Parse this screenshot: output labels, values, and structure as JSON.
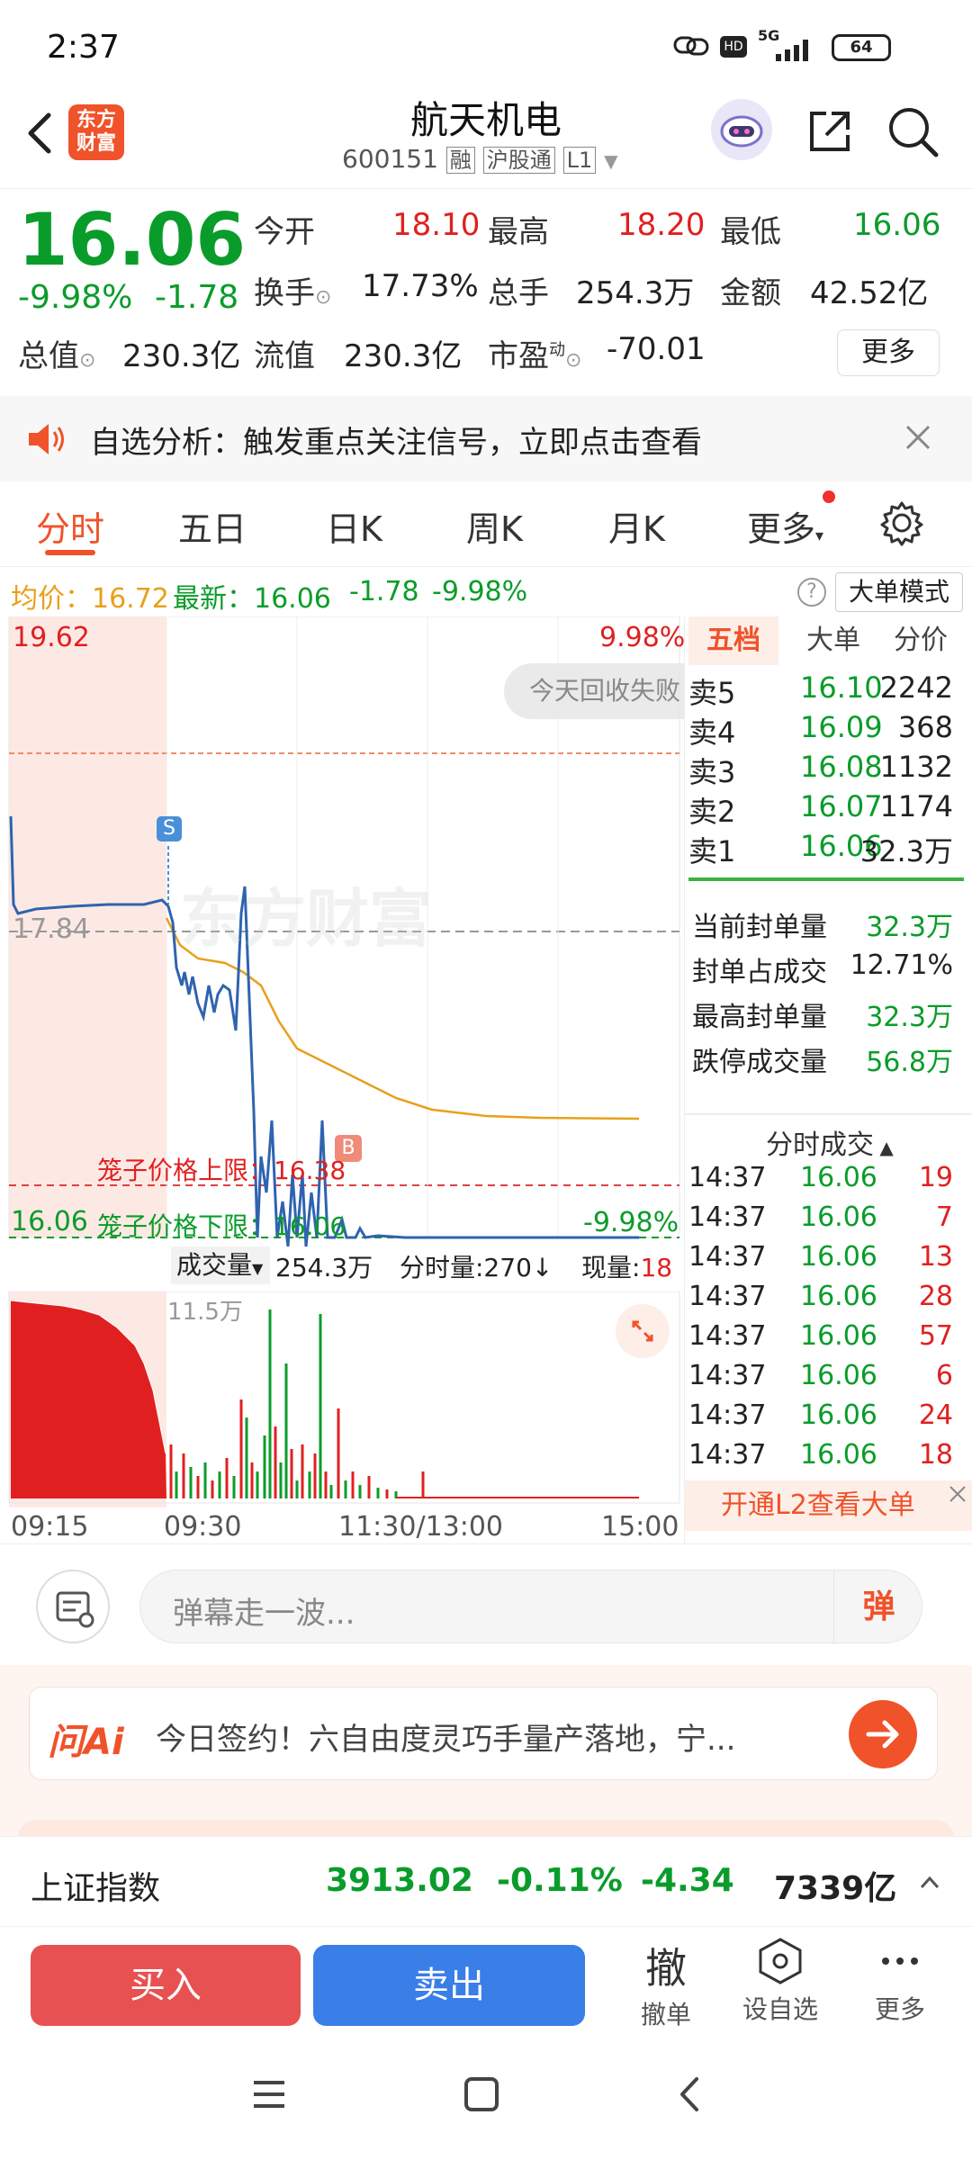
{
  "status_bar": {
    "time": "2:37",
    "network": "5G",
    "battery": "64"
  },
  "header": {
    "stock_name": "航天机电",
    "code": "600151",
    "tag1": "融",
    "tag2": "沪股通",
    "tag3": "L1",
    "brand_line1": "东方",
    "brand_line2": "财富"
  },
  "quote": {
    "price": "16.06",
    "change_pct": "-9.98%",
    "change": "-1.78",
    "open_label": "今开",
    "open": "18.10",
    "high_label": "最高",
    "high": "18.20",
    "low_label": "最低",
    "low": "16.06",
    "turnover_label": "换手",
    "turnover": "17.73%",
    "volume_label": "总手",
    "volume": "254.3万",
    "amount_label": "金额",
    "amount": "42.52亿",
    "mktcap_label": "总值",
    "mktcap": "230.3亿",
    "float_label": "流值",
    "float": "230.3亿",
    "pe_label": "市盈",
    "pe_sup": "动",
    "pe": "-70.01",
    "more_label": "更多"
  },
  "banner": {
    "text": "自选分析：触发重点关注信号，立即点击查看"
  },
  "tabs": [
    "分时",
    "五日",
    "日K",
    "周K",
    "月K",
    "更多"
  ],
  "infobar": {
    "avg_label": "均价：",
    "avg": "16.72",
    "latest_label": "最新：",
    "latest": "16.06",
    "change": "-1.78",
    "change_pct": "-9.98%",
    "mode_label": "大单模式"
  },
  "chart": {
    "top_price": "19.62",
    "top_pct": "9.98%",
    "mid_price": "17.84",
    "bottom_price": "16.06",
    "bottom_pct": "-9.98%",
    "recover_text": "今天回收失败",
    "upper_label": "笼子价格上限：",
    "upper_value": "16.38",
    "lower_label": "笼子价格下限：",
    "lower_value": "16.06",
    "watermark": "东方财富",
    "marker_s": "S",
    "marker_b": "B"
  },
  "volume": {
    "label": "成交量",
    "total": "254.3万",
    "minute_label": "分时量:270",
    "current_label": "现量:",
    "current": "18",
    "max_label": "11.5万"
  },
  "time_axis": [
    "09:15",
    "09:30",
    "11:30/13:00",
    "15:00"
  ],
  "orderbook": {
    "tabs": [
      "五档",
      "大单",
      "分价"
    ],
    "rows": [
      {
        "label": "卖5",
        "price": "16.10",
        "vol": "2242"
      },
      {
        "label": "卖4",
        "price": "16.09",
        "vol": "368"
      },
      {
        "label": "卖3",
        "price": "16.08",
        "vol": "1132"
      },
      {
        "label": "卖2",
        "price": "16.07",
        "vol": "1174"
      },
      {
        "label": "卖1",
        "price": "16.06",
        "vol": "32.3万"
      }
    ]
  },
  "stats": [
    {
      "label": "当前封单量",
      "value": "32.3万"
    },
    {
      "label": "封单占成交",
      "value": "12.71%"
    },
    {
      "label": "最高封单量",
      "value": "32.3万"
    },
    {
      "label": "跌停成交量",
      "value": "56.8万"
    }
  ],
  "trades": {
    "title": "分时成交",
    "rows": [
      {
        "time": "14:37",
        "price": "16.06",
        "vol": "19"
      },
      {
        "time": "14:37",
        "price": "16.06",
        "vol": "7"
      },
      {
        "time": "14:37",
        "price": "16.06",
        "vol": "13"
      },
      {
        "time": "14:37",
        "price": "16.06",
        "vol": "28"
      },
      {
        "time": "14:37",
        "price": "16.06",
        "vol": "57"
      },
      {
        "time": "14:37",
        "price": "16.06",
        "vol": "6"
      },
      {
        "time": "14:37",
        "price": "16.06",
        "vol": "24"
      },
      {
        "time": "14:37",
        "price": "16.06",
        "vol": "18"
      }
    ],
    "l2_label": "开通L2查看大单"
  },
  "danmu": {
    "placeholder": "弹幕走一波...",
    "btn": "弹"
  },
  "ai": {
    "logo": "问Ai",
    "text": "今日签约！六自由度灵巧手量产落地，宁..."
  },
  "index": {
    "name": "上证指数",
    "value": "3913.02",
    "pct": "-0.11%",
    "change": "-4.34",
    "amount": "7339亿"
  },
  "actions": {
    "buy": "买入",
    "sell": "卖出",
    "cancel_icon": "撤",
    "cancel_label": "撤单",
    "watch_label": "设自选",
    "more_label": "更多"
  }
}
